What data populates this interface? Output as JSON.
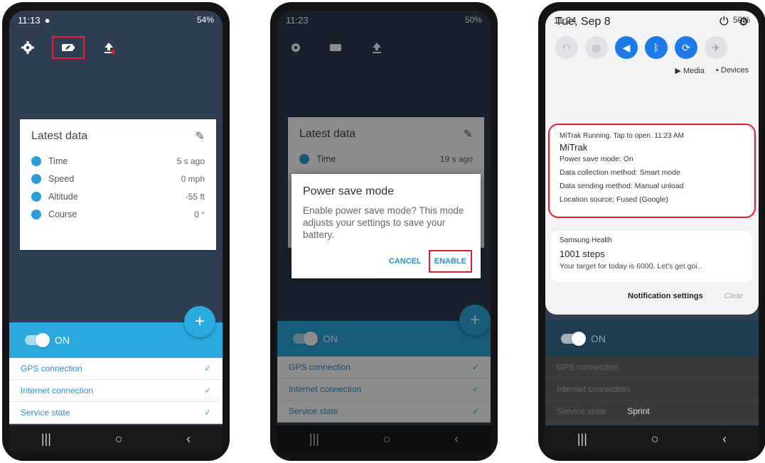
{
  "phone1": {
    "status_time": "11:13",
    "status_right": "54%",
    "card": {
      "title": "Latest data",
      "rows": [
        {
          "label": "Time",
          "value": "5 s ago"
        },
        {
          "label": "Speed",
          "value": "0 mph"
        },
        {
          "label": "Altitude",
          "value": "-55 ft"
        },
        {
          "label": "Course",
          "value": "0 °"
        }
      ]
    },
    "toggle_label": "ON",
    "fab_label": "+",
    "connections": [
      {
        "label": "GPS connection",
        "check": "✓"
      },
      {
        "label": "Internet connection",
        "check": "✓"
      },
      {
        "label": "Service state",
        "check": "✓"
      }
    ]
  },
  "phone2": {
    "status_time": "11:23",
    "status_right": "50%",
    "card_title": "Latest data",
    "row_label": "Time",
    "row_value": "19 s ago",
    "dialog": {
      "title": "Power save mode",
      "body": "Enable power save mode? This mode adjusts your settings to save your battery.",
      "cancel": "CANCEL",
      "enable": "ENABLE"
    },
    "toggle_label": "ON",
    "connections": [
      "GPS connection",
      "Internet connection",
      "Service state"
    ]
  },
  "phone3": {
    "status_time": "11:24",
    "status_right": "50%",
    "date": "Tue, Sep 8",
    "media_label": "Media",
    "devices_label": "Devices",
    "mitrak": {
      "app": "MiTrak",
      "meta": "Running. Tap to open.",
      "time": "11:23 AM",
      "title": "MiTrak",
      "lines": [
        "Power save mode: On",
        "Data collection method: Smart mode",
        "Data sending method: Manual unload",
        "Location source: Fused (Google)"
      ]
    },
    "health": {
      "app": "Samsung Health",
      "title": "1001 steps",
      "body": "Your target for today is 6000. Let's get goi.."
    },
    "notification_settings": "Notification settings",
    "clear": "Clear",
    "toggle_label": "ON",
    "connections": [
      "GPS connection",
      "Internet connection",
      "Service state"
    ],
    "carrier": "Sprint"
  },
  "nav": {
    "recents": "|||",
    "home": "○",
    "back": "‹"
  },
  "colors": {
    "accent": "#2aaadf",
    "highlight": "#e3202c",
    "background": "#2f3f51"
  }
}
